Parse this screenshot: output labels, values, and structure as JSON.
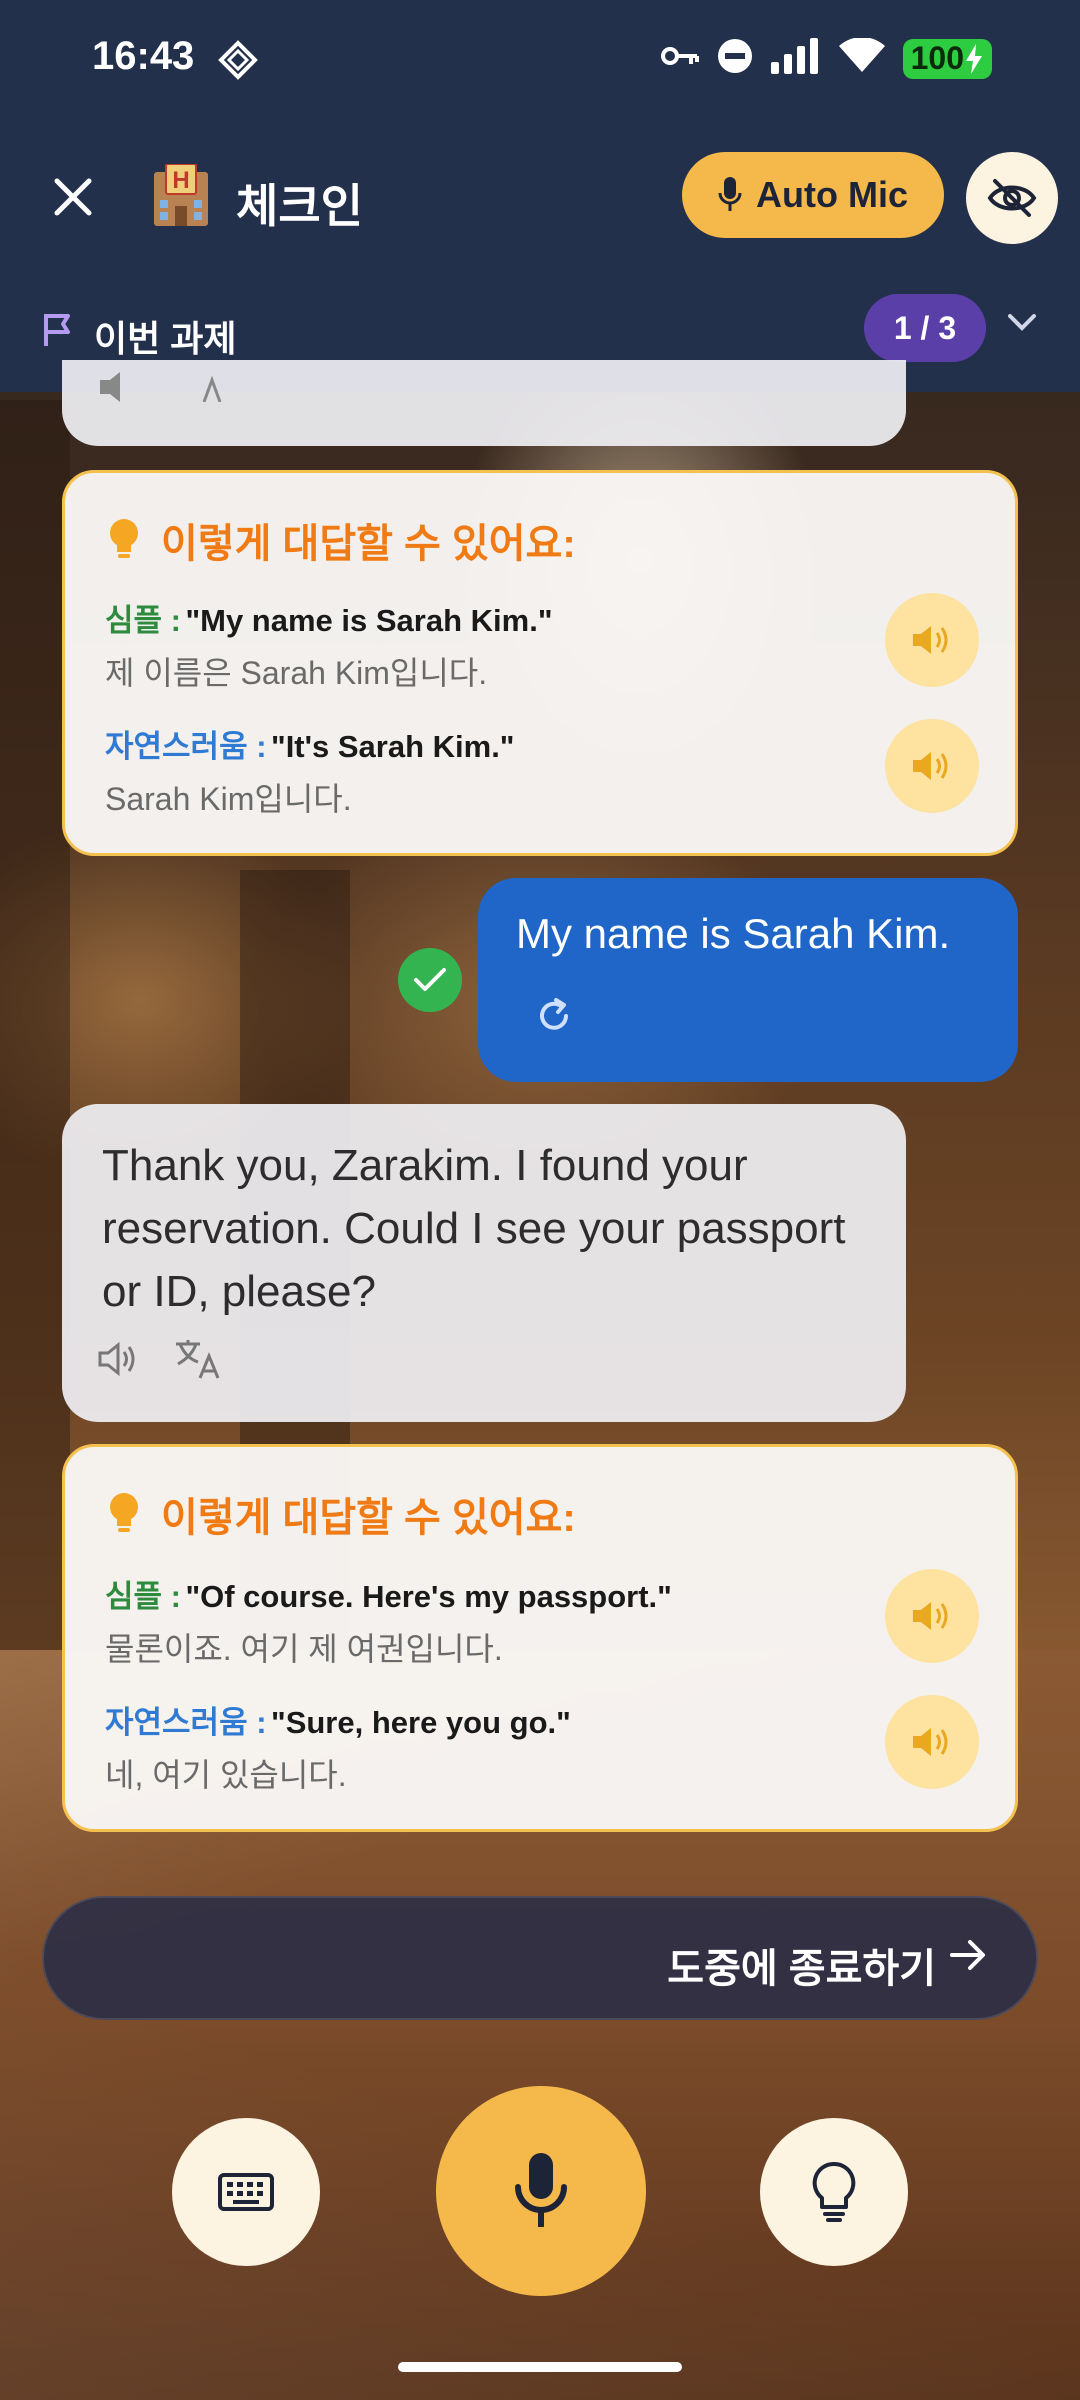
{
  "status_bar": {
    "time": "16:43",
    "battery": "100"
  },
  "header": {
    "title": "체크인",
    "auto_mic_label": "Auto Mic"
  },
  "task": {
    "label": "이번 과제",
    "progress": "1 / 3"
  },
  "hint_cards": [
    {
      "heading": "이렇게 대답할 수 있어요:",
      "options": [
        {
          "type_label": "심플 :",
          "english": "\"My name is Sarah Kim.\"",
          "korean": "제 이름은 Sarah Kim입니다."
        },
        {
          "type_label": "자연스러움 :",
          "english": "\"It's Sarah Kim.\"",
          "korean": "Sarah Kim입니다."
        }
      ]
    },
    {
      "heading": "이렇게 대답할 수 있어요:",
      "options": [
        {
          "type_label": "심플 :",
          "english": "\"Of course. Here's my passport.\"",
          "korean": "물론이죠. 여기 제 여권입니다."
        },
        {
          "type_label": "자연스러움 :",
          "english": "\"Sure, here you go.\"",
          "korean": "네, 여기 있습니다."
        }
      ]
    }
  ],
  "user_message": "My name is Sarah Kim.",
  "ai_message": "Thank you, Zarakim. I found your reservation. Could I see your passport or ID, please?",
  "end_button_label": "도중에 종료하기",
  "colors": {
    "header_bg": "#23304b",
    "accent_yellow": "#f5b94b",
    "user_bubble": "#1f66c8",
    "hint_heading": "#f07a13",
    "simple_label": "#2e8b3e",
    "natural_label": "#2f7ad2",
    "progress_pill": "#5b3fa8"
  },
  "icons": {
    "close": "close-icon",
    "hotel": "hotel-icon",
    "mic": "mic-icon",
    "hide": "eye-off-icon",
    "flag": "flag-icon",
    "chevron": "chevron-down-icon",
    "speaker": "speaker-icon",
    "translate": "translate-icon",
    "bulb": "lightbulb-icon",
    "check": "check-icon",
    "retry": "retry-icon",
    "keyboard": "keyboard-icon",
    "arrow": "arrow-right-icon"
  }
}
